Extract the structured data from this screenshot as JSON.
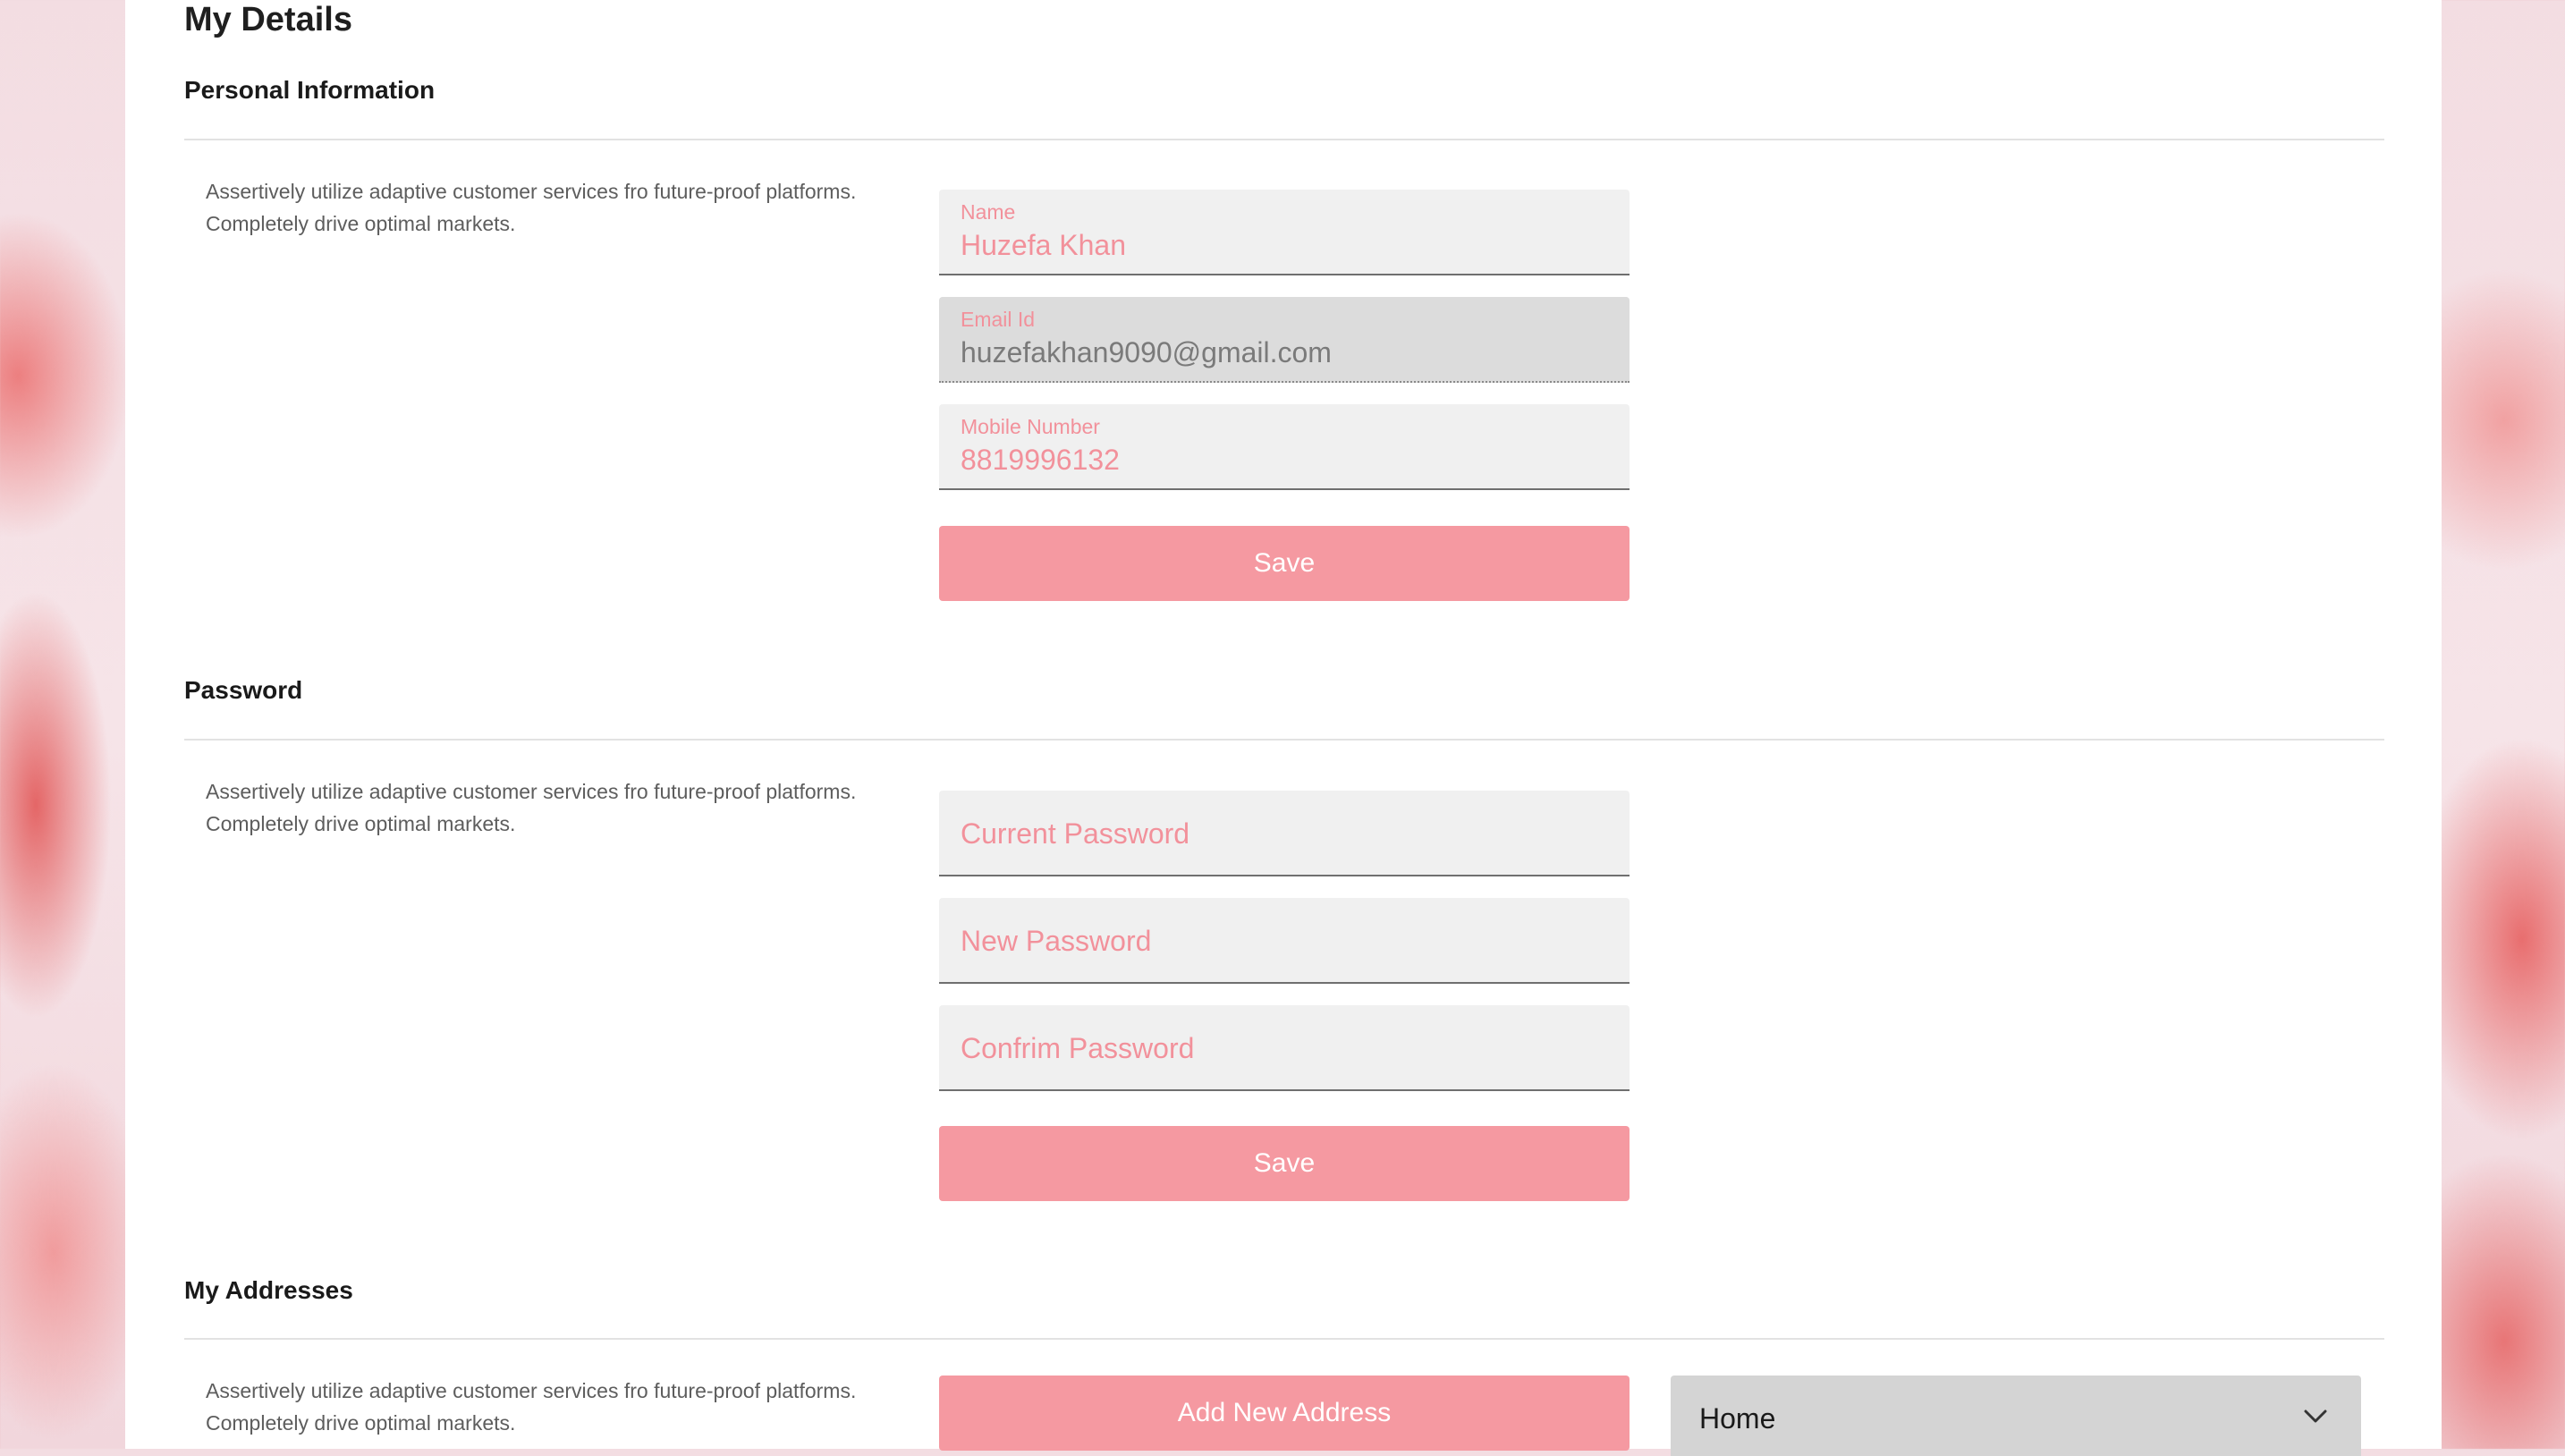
{
  "page": {
    "title": "My Details"
  },
  "personal": {
    "title": "Personal Information",
    "description": "Assertively utilize adaptive customer services fro future-proof platforms. Completely drive optimal markets.",
    "name": {
      "label": "Name",
      "value": "Huzefa Khan"
    },
    "email": {
      "label": "Email Id",
      "value": "huzefakhan9090@gmail.com"
    },
    "mobile": {
      "label": "Mobile Number",
      "value": "8819996132"
    },
    "save_label": "Save"
  },
  "password": {
    "title": "Password",
    "description": "Assertively utilize adaptive customer services fro future-proof platforms. Completely drive optimal markets.",
    "current_placeholder": "Current Password",
    "new_placeholder": "New Password",
    "confirm_placeholder": "Confrim Password",
    "save_label": "Save"
  },
  "addresses": {
    "title": "My Addresses",
    "description": "Assertively utilize adaptive customer services fro future-proof platforms. Completely drive optimal markets.",
    "add_label": "Add New Address",
    "select_value": "Home",
    "select_icon": "chevron-down-icon"
  },
  "colors": {
    "accent": "#f599a1",
    "accent_text": "#f2919b",
    "field_bg": "#f0f0f0",
    "disabled_bg": "#dcdcdc",
    "select_bg": "#d4d4d4"
  }
}
